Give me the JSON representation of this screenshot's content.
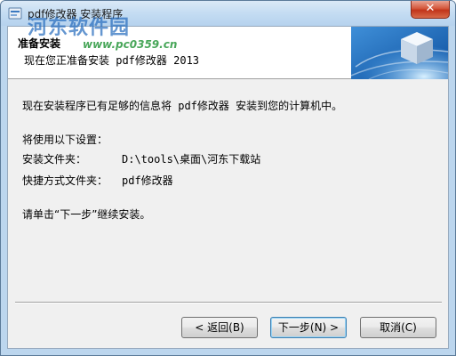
{
  "window": {
    "title": "pdf修改器 安装程序",
    "close_label": "✕"
  },
  "watermark": {
    "text": "河东软件园",
    "url": "www.pc0359.cn"
  },
  "header": {
    "title": "准备安装",
    "subtitle": "现在您正准备安装 pdf修改器 2013"
  },
  "content": {
    "intro": "现在安装程序已有足够的信息将 pdf修改器 安装到您的计算机中。",
    "settings_heading": "将使用以下设置：",
    "install_folder_label": "安装文件夹：",
    "install_folder_value": "D:\\tools\\桌面\\河东下载站",
    "shortcut_folder_label": "快捷方式文件夹：",
    "shortcut_folder_value": "pdf修改器",
    "instruction": "请单击“下一步”继续安装。"
  },
  "buttons": {
    "back": "< 返回(B)",
    "next": "下一步(N) >",
    "cancel": "取消(C)"
  },
  "colors": {
    "titlebar": "#c4dcf2",
    "client_bg": "#f0f0f0",
    "header_bg": "#ffffff",
    "close_button": "#c1341a"
  }
}
